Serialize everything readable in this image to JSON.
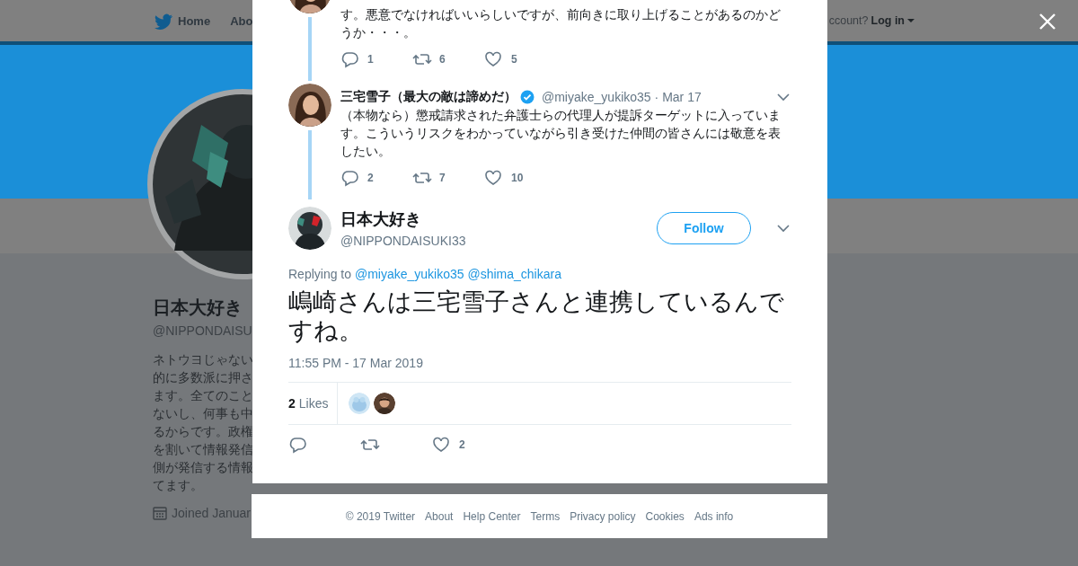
{
  "nav": {
    "items": [
      {
        "label": "Home",
        "selected": false
      },
      {
        "label": "Abo",
        "selected": false
      }
    ],
    "account_prompt": "ccount?",
    "login": "Log in"
  },
  "profile": {
    "name": "日本大好き",
    "handle": "@NIPPONDAISU",
    "bio_lines": [
      "ネトウヨじゃない",
      "的に多数派に押さ",
      "ます。全てのこと",
      "ないし、何事も中",
      "るからです。政権",
      "を割いて情報発信",
      "側が発信する情報",
      "てます。"
    ],
    "joined": "Joined Januar"
  },
  "thread": [
    {
      "text": "す。悪意でなければいいらしいですが、前向きに取り上げることがあるのかどうか・・・。",
      "replies": "1",
      "retweets": "6",
      "likes": "5"
    },
    {
      "name": "三宅雪子（最大の敵は諦めだ）",
      "verified": true,
      "handle": "@miyake_yukiko35",
      "date": "· Mar 17",
      "text": "（本物なら）懲戒請求された弁護士らの代理人が提訴ターゲットに入っています。こういうリスクをわかっていながら引き受けた仲間の皆さんには敬意を表したい。",
      "replies": "2",
      "retweets": "7",
      "likes": "10"
    }
  ],
  "tweet": {
    "name": "日本大好き",
    "handle": "@NIPPONDAISUKI33",
    "follow": "Follow",
    "replying_label": "Replying to",
    "mentions": [
      "@miyake_yukiko35",
      "@shima_chikara"
    ],
    "text": "嶋崎さんは三宅雪子さんと連携しているんですね。",
    "timestamp": "11:55 PM - 17 Mar 2019",
    "likes_count": "2",
    "likes_label": "Likes",
    "likes": "2"
  },
  "footer": [
    "© 2019 Twitter",
    "About",
    "Help Center",
    "Terms",
    "Privacy policy",
    "Cookies",
    "Ads info"
  ]
}
